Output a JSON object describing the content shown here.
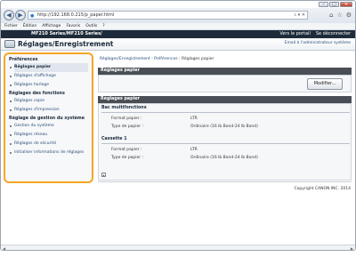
{
  "browser": {
    "url": "http://192.168.0.215/p_paper.html",
    "menu": [
      "Fichier",
      "Édition",
      "Affichage",
      "Favoris",
      "Outils",
      "?"
    ]
  },
  "header": {
    "model": "MF210 Series/MF210 Series/",
    "portal_link": "Vers le portail",
    "logout_link": "Se déconnecter",
    "page_title": "Réglages/Enregistrement",
    "admin_mail": "Email à l'administrateur système"
  },
  "sidebar": {
    "groups": [
      {
        "title": "Préférences",
        "items": [
          "Réglages papier",
          "Réglages d'affichage",
          "Réglages horloge"
        ]
      },
      {
        "title": "Réglages des fonctions",
        "items": [
          "Réglages copie",
          "Réglages d'impression"
        ]
      },
      {
        "title": "Réglage de gestion du système",
        "items": [
          "Gestion du système",
          "Réglages réseau",
          "Réglages de sécurité",
          "Initialiser informations de réglages"
        ]
      }
    ]
  },
  "main": {
    "breadcrumb": {
      "a": "Réglages/Enregistrement",
      "sep1": " : ",
      "b": "Préférences",
      "sep2": " : ",
      "c": "Réglages papier"
    },
    "panel1_title": "Réglages papier",
    "modify_button": "Modifier...",
    "panel2_title": "Réglages papier",
    "groups": [
      {
        "title": "Bac multifonctions",
        "rows": [
          {
            "label": "Format papier :",
            "value": "LTR"
          },
          {
            "label": "Type de papier :",
            "value": "Ordinaire (16 lb Bond-24 lb Bond)"
          }
        ]
      },
      {
        "title": "Cassette 1",
        "rows": [
          {
            "label": "Format papier :",
            "value": "LTR"
          },
          {
            "label": "Type de papier :",
            "value": "Ordinaire (16 lb Bond-24 lb Bond)"
          }
        ]
      }
    ],
    "copyright": "Copyright CANON INC. 2014"
  }
}
